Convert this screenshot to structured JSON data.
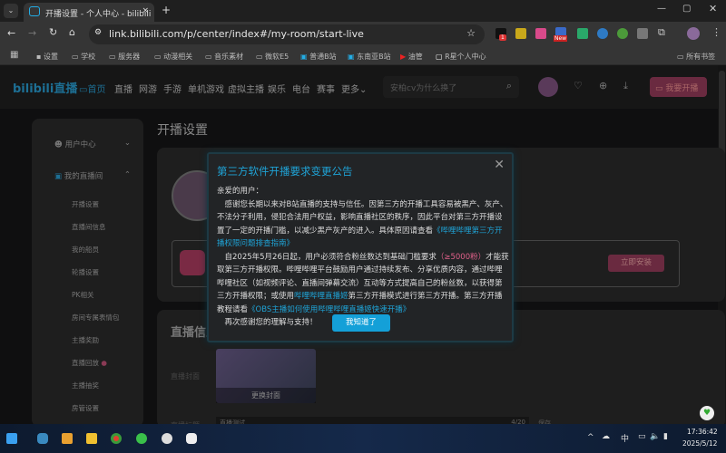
{
  "browser": {
    "tab_title": "开播设置 - 个人中心 - bilibili l",
    "url": "link.bilibili.com/p/center/index#/my-room/start-live",
    "new_tab": "+",
    "ext_badge_count": "1",
    "ext_badge_new": "New"
  },
  "bookmarks": [
    "设置",
    "学校",
    "服务器",
    "动漫相关",
    "音乐素材",
    "微软E5",
    "普通B站",
    "东南亚B站",
    "油管",
    "R星个人中心"
  ],
  "all_bookmarks": "所有书签",
  "header": {
    "logo": "bilibili直播",
    "nav": [
      "首页",
      "直播",
      "网游",
      "手游",
      "单机游戏",
      "虚拟主播",
      "娱乐",
      "电台",
      "赛事",
      "更多"
    ],
    "search_placeholder": "安柏cv为什么换了",
    "start_live": "我要开播"
  },
  "sidebar": {
    "user_center": "用户中心",
    "my_room": "我的直播间",
    "items": [
      "开播设置",
      "直播间信息",
      "我的船员",
      "轮播设置",
      "PK相关",
      "房间专属表情包",
      "主播奖励",
      "直播回放",
      "主播抽奖",
      "房管设置"
    ]
  },
  "main": {
    "page_title": "开播设置",
    "install_button": "立即安装",
    "live_info_title": "直播信息",
    "cover_label": "直播封面",
    "change_cover": "更换封面",
    "title_label": "直播标题",
    "title_value": "直播测试",
    "title_count": "4/20",
    "save": "保存"
  },
  "modal": {
    "title": "第三方软件开播要求变更公告",
    "greeting": "亲爱的用户：",
    "p1": "　感谢您长期以来对B站直播的支持与信任。因第三方的开播工具容易被黑产、灰产、不法分子利用，侵犯合法用户权益，影响直播社区的秩序，因此平台对第三方开播设置了一定的开播门槛，以减少黑产灰产的进入。具体原因请查看",
    "p1_link": "《哔哩哔哩第三方开播权限问题排查指南》",
    "p2a": "　自2025年5月26日起，用户必须符合粉丝数达到基础门槛要求",
    "p2_pink": "（≥5000粉）",
    "p2b": "才能获取第三方开播权限。哔哩哔哩平台鼓励用户通过持续发布、分享优质内容，通过哔哩哔哩社区（如视频评论、直播间弹幕交流）互动等方式提高自己的粉丝数，以获得第三方开播权限；或使用",
    "p2_link1": "哔哩哔哩直播姬",
    "p2c": "第三方开播模式进行第三方开播。第三方开播教程请看",
    "p2_link2": "《OBS主播如何使用哔哩哔哩直播姬快速开播》",
    "p3": "　再次感谢您的理解与支持！",
    "confirm": "我知道了"
  },
  "taskbar": {
    "ime": "中",
    "time": "17:36:42",
    "date": "2025/5/12"
  },
  "colors": {
    "accent": "#1fa3d6",
    "pink": "#e0608a",
    "start_live": "#a03a5a"
  }
}
